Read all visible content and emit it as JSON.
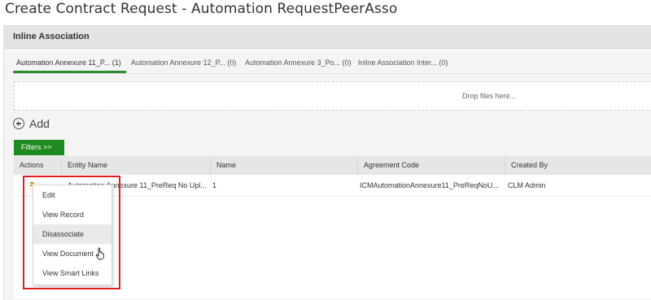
{
  "page": {
    "title": "Create Contract Request - Automation RequestPeerAsso"
  },
  "section": {
    "header": "Inline Association"
  },
  "tabs": [
    {
      "label": "Automation Annexure 11_P... (1)",
      "active": true
    },
    {
      "label": "Automation Annexure 12_P... (0)",
      "active": false
    },
    {
      "label": "Automation Annexure 3_Po... (0)",
      "active": false
    },
    {
      "label": "Inline Association Inter... (0)",
      "active": false
    }
  ],
  "dropzone": {
    "text": "Drop files here..."
  },
  "add": {
    "label": "Add",
    "icon": "plus-circle-icon"
  },
  "filters": {
    "label": "Filters >>"
  },
  "grid": {
    "columns": [
      "Actions",
      "Entity Name",
      "Name",
      "Agreement Code",
      "Created By"
    ],
    "rows": [
      {
        "entity_name": "Automation Annexure 11_PreReq No Upl...",
        "name": "1",
        "agreement_code": "ICMAutomationAnnexure11_PreReqNoU...",
        "created_by": "CLM Admin"
      }
    ]
  },
  "context_menu": {
    "items": [
      "Edit",
      "View Record",
      "Disassociate",
      "View Document",
      "View Smart Links"
    ],
    "hovered_index": 2
  },
  "colors": {
    "accent_green": "#1f8a1f",
    "highlight_red": "#e01e1e"
  }
}
